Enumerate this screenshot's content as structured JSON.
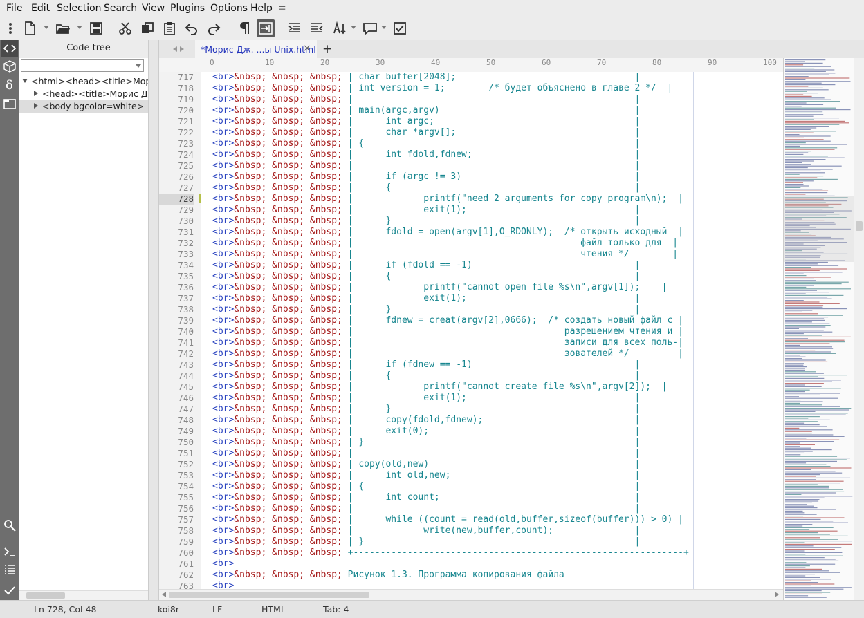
{
  "menu": {
    "items": [
      "File",
      "Edit",
      "Selection",
      "Search",
      "View",
      "Plugins",
      "Options",
      "Help"
    ],
    "extra": "≡"
  },
  "panel": {
    "title": "Code tree",
    "filter_value": "",
    "tree": [
      {
        "text": "<html><head><title>Морис Дж. Бах"
      },
      {
        "text": "<head><title>Морис Дж. Бах"
      },
      {
        "text": "<body bgcolor=white>"
      }
    ]
  },
  "tab": {
    "label": "*Морис Дж. ...ы Unix.html",
    "close": "×",
    "add": "+"
  },
  "ruler": [
    "0",
    "10",
    "20",
    "30",
    "40",
    "50",
    "60",
    "70",
    "80",
    "90",
    "100"
  ],
  "editor": {
    "current_line": 728,
    "line_numbers": [
      "717",
      "718",
      "719",
      "720",
      "721",
      "722",
      "723",
      "724",
      "725",
      "726",
      "727",
      "728",
      "729",
      "730",
      "731",
      "732",
      "733",
      "734",
      "735",
      "736",
      "737",
      "738",
      "739",
      "740",
      "741",
      "742",
      "743",
      "744",
      "745",
      "746",
      "747",
      "748",
      "749",
      "750",
      "751",
      "752",
      "753",
      "754",
      "755",
      "756",
      "757",
      "758",
      "759",
      "760",
      "761",
      "762",
      "763"
    ],
    "prefix": "<br>&nbsp; &nbsp; &nbsp;",
    "lines": [
      " | char buffer[2048];                                 |",
      " | int version = 1;        /* будет объяснено в главе 2 */  |",
      " |                                                    |",
      " | main(argc,argv)                                    |",
      " |      int argc;                                     |",
      " |      char *argv[];                                 |",
      " | {                                                  |",
      " |      int fdold,fdnew;                              |",
      " |                                                    |",
      " |      if (argc != 3)                                |",
      " |      {                                             |",
      " |             printf(\"need 2 arguments for copy program\\n);  |",
      " |             exit(1);                               |",
      " |      }                                             |",
      " |      fdold = open(argv[1],O_RDONLY);  /* открыть исходный  |",
      " |                                          файл только для  |",
      " |                                          чтения */        |",
      " |      if (fdold == -1)                              |",
      " |      {                                             |",
      " |             printf(\"cannot open file %s\\n\",argv[1]);    |",
      " |             exit(1);                               |",
      " |      }                                             |",
      " |      fdnew = creat(argv[2],0666);  /* создать новый файл с |",
      " |                                       разрешением чтения и |",
      " |                                       записи для всех поль-|",
      " |                                       зователей */         |",
      " |      if (fdnew == -1)                              |",
      " |      {                                             |",
      " |             printf(\"cannot create file %s\\n\",argv[2]);  |",
      " |             exit(1);                               |",
      " |      }                                             |",
      " |      copy(fdold,fdnew);                            |",
      " |      exit(0);                                      |",
      " | }                                                  |",
      " |                                                    |",
      " | copy(old,new)                                      |",
      " |      int old,new;                                  |",
      " | {                                                  |",
      " |      int count;                                    |",
      " |                                                    |",
      " |      while ((count = read(old,buffer,sizeof(buffer))) > 0) |",
      " |             write(new,buffer,count);               |",
      " | }                                                  |",
      " +-------------------------------------------------------------+",
      "",
      " Рисунок 1.3. Программа копирования файла",
      ""
    ]
  },
  "status": {
    "position": "Ln 728, Col 48",
    "encoding": "koi8r",
    "line_ending": "LF",
    "lexer": "HTML",
    "tab": "Tab: 4",
    "tab_dash": "-"
  },
  "colors": {
    "tag": "#2b44c0",
    "entity": "#a61b1b",
    "box": "#17868f",
    "string": "#1f7a1f",
    "number": "#17195c"
  }
}
